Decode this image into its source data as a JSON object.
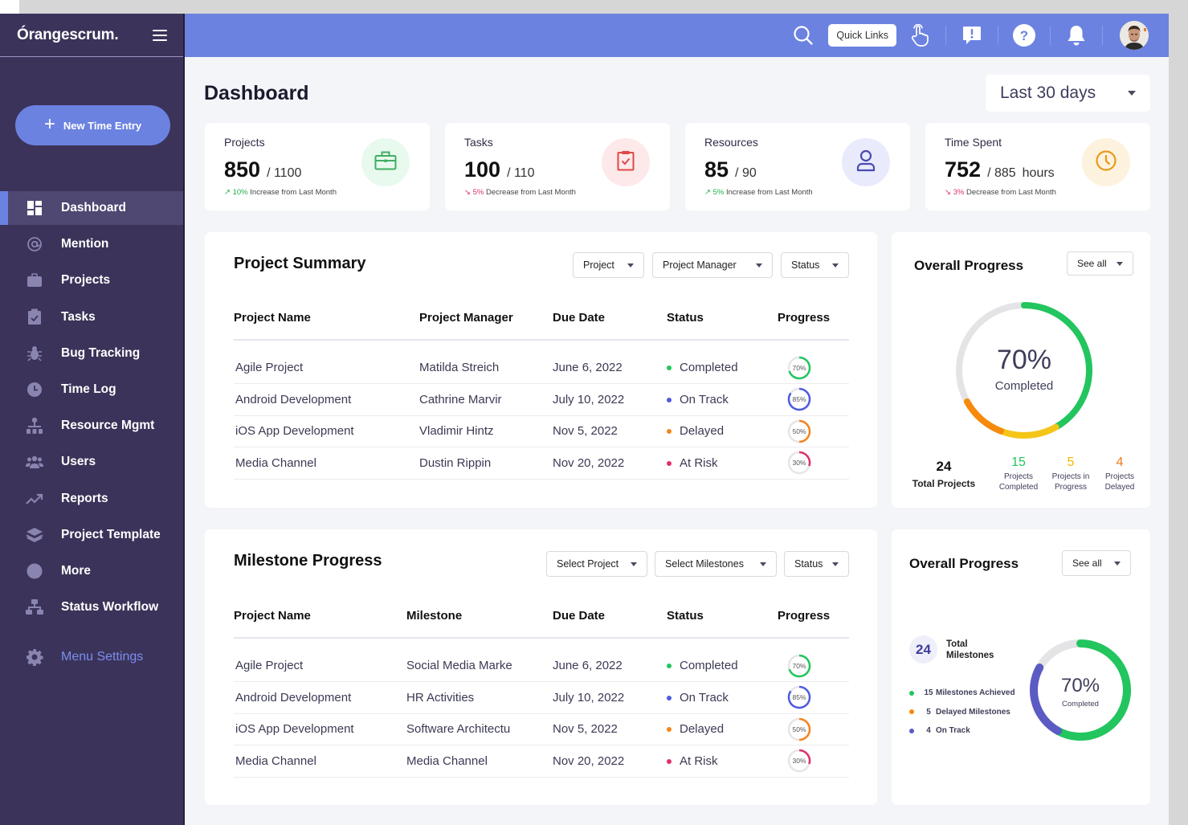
{
  "app": {
    "logo": "Órangescrum."
  },
  "sidebar": {
    "new_entry_label": "New Time Entry",
    "items": [
      {
        "label": "Dashboard",
        "icon": "dashboard-icon",
        "active": true
      },
      {
        "label": "Mention",
        "icon": "at-icon"
      },
      {
        "label": "Projects",
        "icon": "briefcase-icon"
      },
      {
        "label": "Tasks",
        "icon": "clipboard-check-icon"
      },
      {
        "label": "Bug Tracking",
        "icon": "bug-icon"
      },
      {
        "label": "Time Log",
        "icon": "clock-icon"
      },
      {
        "label": "Resource Mgmt",
        "icon": "org-chart-icon"
      },
      {
        "label": "Users",
        "icon": "users-icon"
      },
      {
        "label": "Reports",
        "icon": "trend-up-icon"
      },
      {
        "label": "Project Template",
        "icon": "layers-icon"
      },
      {
        "label": "More",
        "icon": "circle-icon"
      },
      {
        "label": "Status Workflow",
        "icon": "workflow-icon"
      }
    ],
    "settings_label": "Menu Settings"
  },
  "topbar": {
    "quick_links_label": "Quick Links",
    "icons": [
      "search-icon",
      "hand-pointer-icon",
      "feedback-icon",
      "help-icon",
      "bell-icon",
      "user-avatar"
    ]
  },
  "page": {
    "title": "Dashboard",
    "date_range": "Last 30 days"
  },
  "stats": [
    {
      "label": "Projects",
      "value": "850",
      "total": "/ 1100",
      "unit": "",
      "change_pct": "10%",
      "change_text": "Increase from Last Month",
      "direction": "up",
      "icon": "briefcase-icon",
      "color": "#3fae63",
      "bg": "#e8f9ee"
    },
    {
      "label": "Tasks",
      "value": "100",
      "total": "/ 110",
      "unit": "",
      "change_pct": "5%",
      "change_text": "Decrease from Last Month",
      "direction": "down",
      "icon": "clipboard-check-icon",
      "color": "#e04848",
      "bg": "#fde9e9"
    },
    {
      "label": "Resources",
      "value": "85",
      "total": "/ 90",
      "unit": "",
      "change_pct": "5%",
      "change_text": "Increase from Last Month",
      "direction": "up",
      "icon": "user-icon",
      "color": "#4a4ab0",
      "bg": "#e9eafb"
    },
    {
      "label": "Time Spent",
      "value": "752",
      "total": "/ 885",
      "unit": "hours",
      "change_pct": "3%",
      "change_text": "Decrease from Last Month",
      "direction": "down",
      "icon": "clock-icon",
      "color": "#e89a1c",
      "bg": "#fdf2de"
    }
  ],
  "status_colors": {
    "Completed": "#22c55e",
    "On Track": "#4f5be0",
    "Delayed": "#f5851f",
    "At Risk": "#e0306a"
  },
  "project_summary": {
    "title": "Project Summary",
    "filters": [
      "Project",
      "Project Manager",
      "Status"
    ],
    "columns": [
      "Project Name",
      "Project Manager",
      "Due Date",
      "Status",
      "Progress"
    ],
    "rows": [
      {
        "name": "Agile Project",
        "manager": "Matilda Streich",
        "due": "June 6, 2022",
        "status": "Completed",
        "progress": 70
      },
      {
        "name": "Android Development",
        "manager": "Cathrine Marvir",
        "due": "July 10, 2022",
        "status": "On Track",
        "progress": 85
      },
      {
        "name": "iOS App Development",
        "manager": "Vladimir Hintz",
        "due": "Nov 5, 2022",
        "status": "Delayed",
        "progress": 50
      },
      {
        "name": "Media Channel",
        "manager": "Dustin Rippin",
        "due": "Nov 20, 2022",
        "status": "At Risk",
        "progress": 30
      }
    ]
  },
  "milestone_progress": {
    "title": "Milestone Progress",
    "filters": [
      "Select Project",
      "Select Milestones",
      "Status"
    ],
    "columns": [
      "Project Name",
      "Milestone",
      "Due Date",
      "Status",
      "Progress"
    ],
    "rows": [
      {
        "name": "Agile Project",
        "milestone": "Social Media Marke",
        "due": "June 6, 2022",
        "status": "Completed",
        "progress": 70
      },
      {
        "name": "Android Development",
        "milestone": "HR Activities",
        "due": "July 10, 2022",
        "status": "On Track",
        "progress": 85
      },
      {
        "name": "iOS App Development",
        "milestone": "Software Architectu",
        "due": "Nov 5, 2022",
        "status": "Delayed",
        "progress": 50
      },
      {
        "name": "Media Channel",
        "milestone": "Media Channel",
        "due": "Nov 20, 2022",
        "status": "At Risk",
        "progress": 30
      }
    ]
  },
  "overall_projects": {
    "title": "Overall Progress",
    "see_all": "See all",
    "percent_label": "70%",
    "completed_label": "Completed",
    "segments": [
      {
        "name": "Completed",
        "value": 15,
        "color": "#22c55e"
      },
      {
        "name": "In Progress",
        "value": 5,
        "color": "#f5c518"
      },
      {
        "name": "Delayed",
        "value": 4,
        "color": "#f58a0b"
      }
    ],
    "remaining_fraction": 0.33,
    "total": {
      "value": "24",
      "label": "Total Projects"
    },
    "breakdown": [
      {
        "value": "15",
        "label": "Projects Completed",
        "color": "#22c55e"
      },
      {
        "value": "5",
        "label": "Projects in Progress",
        "color": "#f5b800"
      },
      {
        "value": "4",
        "label": "Projects Delayed",
        "color": "#ef7a1a"
      }
    ]
  },
  "overall_milestones": {
    "title": "Overall Progress",
    "see_all": "See all",
    "total_value": "24",
    "total_label": "Total Milestones",
    "percent_label": "70%",
    "completed_label": "Completed",
    "legend": [
      {
        "count": "15",
        "label": "Milestones Achieved",
        "color": "#22c55e"
      },
      {
        "count": "5",
        "label": "Delayed Milestones",
        "color": "#f58a0b"
      },
      {
        "count": "4",
        "label": "On Track",
        "color": "#5a5ac8"
      }
    ],
    "ring": [
      {
        "name": "Achieved",
        "fraction": 0.58,
        "color": "#22c55e"
      },
      {
        "name": "On Track",
        "fraction": 0.25,
        "color": "#5b5bc4"
      }
    ]
  }
}
